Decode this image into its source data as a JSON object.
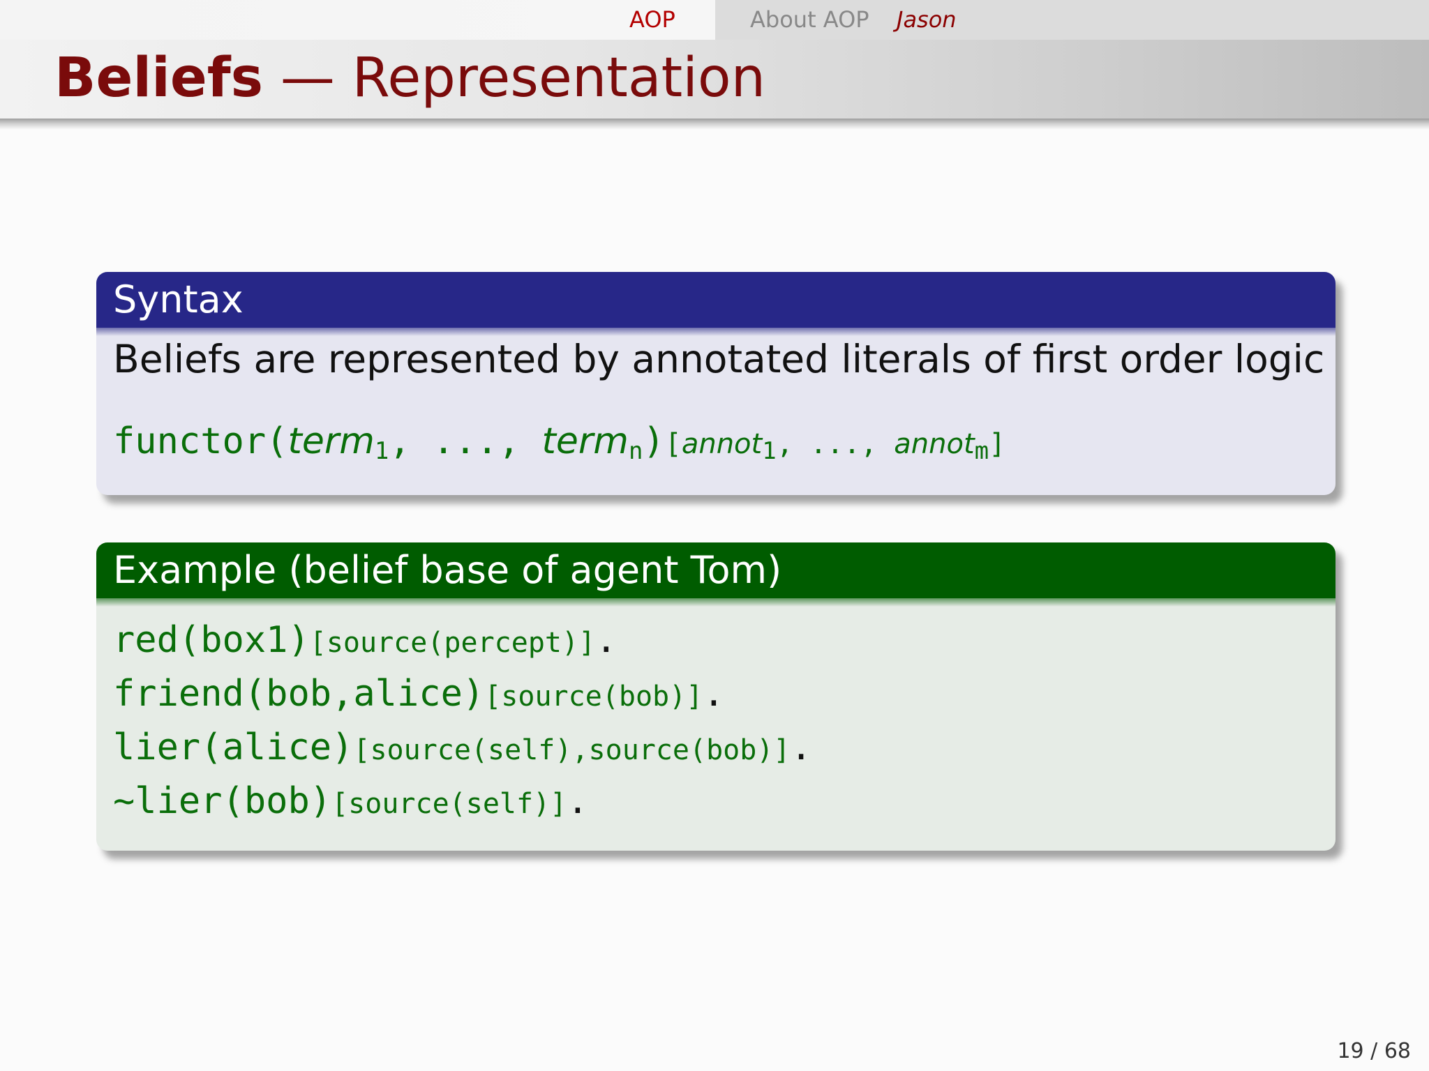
{
  "nav": {
    "section": "AOP",
    "subsections": [
      "About AOP",
      "Jason"
    ]
  },
  "title": {
    "bold": "Beliefs",
    "rest": " — Representation"
  },
  "syntax_block": {
    "header": "Syntax",
    "text": "Beliefs are represented by annotated literals of first order logic",
    "formula": {
      "functor": "functor(",
      "term1": "term",
      "sub1": "1",
      "sep1": ", ..., ",
      "termn": "term",
      "subn": "n",
      "close": ")",
      "annot_open": "[",
      "annot1": "annot",
      "asub1": "1",
      "sep2": ", ..., ",
      "annotm": "annot",
      "asubm": "m",
      "annot_close": "]"
    }
  },
  "example_block": {
    "header": "Example (belief base of agent Tom)",
    "lines": [
      {
        "literal": "red(box1)",
        "annotation": "[source(percept)]",
        "end": "."
      },
      {
        "literal": "friend(bob,alice)",
        "annotation": "[source(bob)]",
        "end": "."
      },
      {
        "literal": "lier(alice)",
        "annotation": "[source(self),source(bob)]",
        "end": "."
      },
      {
        "literal": "~lier(bob)",
        "annotation": "[source(self)]",
        "end": "."
      }
    ]
  },
  "footer": {
    "page": "19 / 68"
  }
}
